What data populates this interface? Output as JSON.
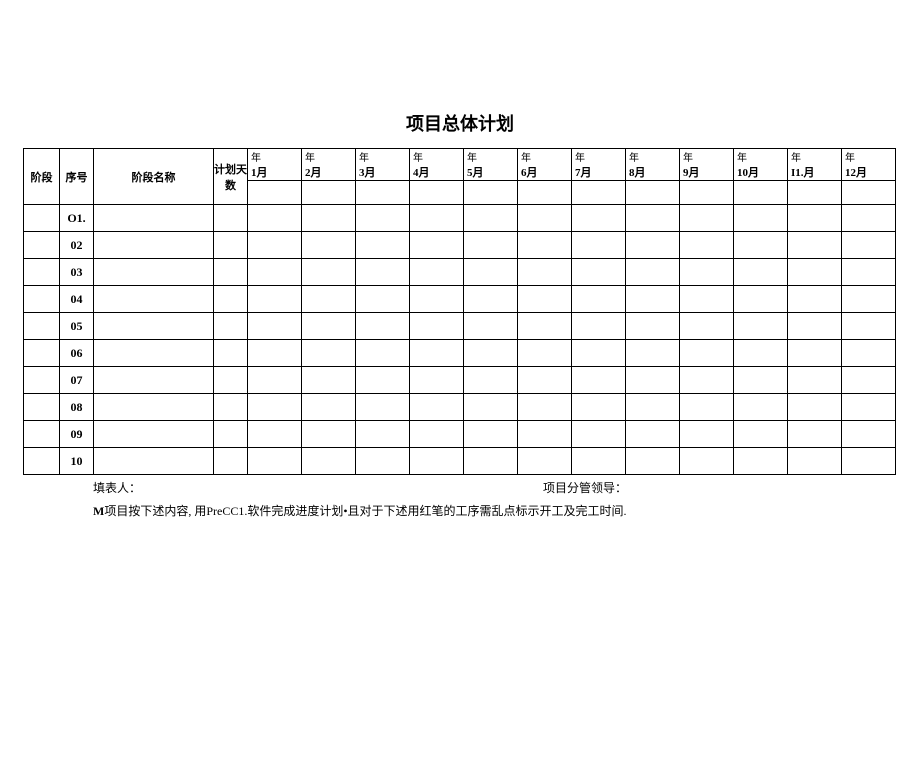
{
  "title": "项目总体计划",
  "headers": {
    "stage": "阶段",
    "seq": "序号",
    "name": "阶段名称",
    "days": "计划天数"
  },
  "months": [
    {
      "top": "年",
      "bot": "1月"
    },
    {
      "top": "年",
      "bot": "2月"
    },
    {
      "top": "年",
      "bot": "3月"
    },
    {
      "top": "年",
      "bot": "4月"
    },
    {
      "top": "年",
      "bot": "5月"
    },
    {
      "top": "年",
      "bot": "6月"
    },
    {
      "top": "年",
      "bot": "7月"
    },
    {
      "top": "年",
      "bot": "8月"
    },
    {
      "top": "年",
      "bot": "9月"
    },
    {
      "top": "年",
      "bot": "10月"
    },
    {
      "top": "年",
      "bot": "I1.月"
    },
    {
      "top": "年",
      "bot": "12月"
    }
  ],
  "rows": [
    {
      "seq": "O1."
    },
    {
      "seq": "02"
    },
    {
      "seq": "03"
    },
    {
      "seq": "04"
    },
    {
      "seq": "05"
    },
    {
      "seq": "06"
    },
    {
      "seq": "07"
    },
    {
      "seq": "08"
    },
    {
      "seq": "09"
    },
    {
      "seq": "10"
    }
  ],
  "footer": {
    "preparer": "填表人：",
    "leader": "项目分管领导："
  },
  "note": {
    "prefix": "M",
    "text": "项目按下述内容, 用PreCC1.软件完成进度计划•且对于下述用红笔的工序需乱点标示开工及完工时间."
  }
}
